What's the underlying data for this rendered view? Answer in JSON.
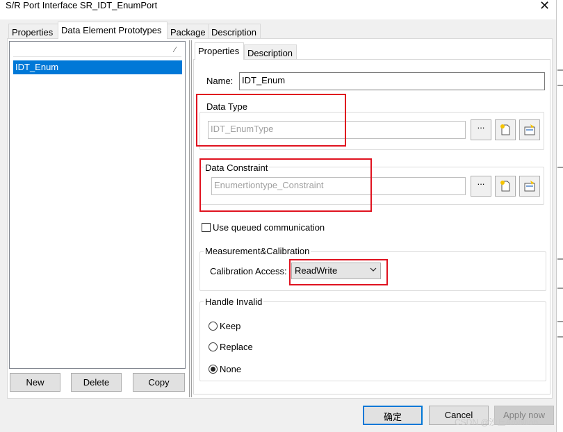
{
  "window": {
    "title": "S/R Port Interface SR_IDT_EnumPort"
  },
  "outer_tabs": [
    "Properties",
    "Data Element Prototypes",
    "Package",
    "Description"
  ],
  "element_list": {
    "items": [
      "IDT_Enum"
    ]
  },
  "list_buttons": {
    "new": "New",
    "delete": "Delete",
    "copy": "Copy"
  },
  "inner_tabs": [
    "Properties",
    "Description"
  ],
  "form": {
    "name_label": "Name:",
    "name_value": "IDT_Enum",
    "data_type": {
      "label": "Data Type",
      "value": "IDT_EnumType",
      "browse": "..."
    },
    "data_constraint": {
      "label": "Data Constraint",
      "value": "Enumertiontype_Constraint",
      "browse": "..."
    },
    "queued_label": "Use queued communication",
    "measurement": {
      "label": "Measurement&Calibration",
      "calibration_label": "Calibration Access:",
      "calibration_value": "ReadWrite"
    },
    "handle_invalid": {
      "label": "Handle Invalid",
      "options": [
        "Keep",
        "Replace",
        "None"
      ],
      "selected": "None"
    }
  },
  "dialog_buttons": {
    "ok": "确定",
    "cancel": "Cancel",
    "apply": "Apply now"
  },
  "watermark": "CSDN @沙丘Ambition",
  "colors": {
    "selection": "#0078d7",
    "highlight_box": "#e0121f"
  }
}
